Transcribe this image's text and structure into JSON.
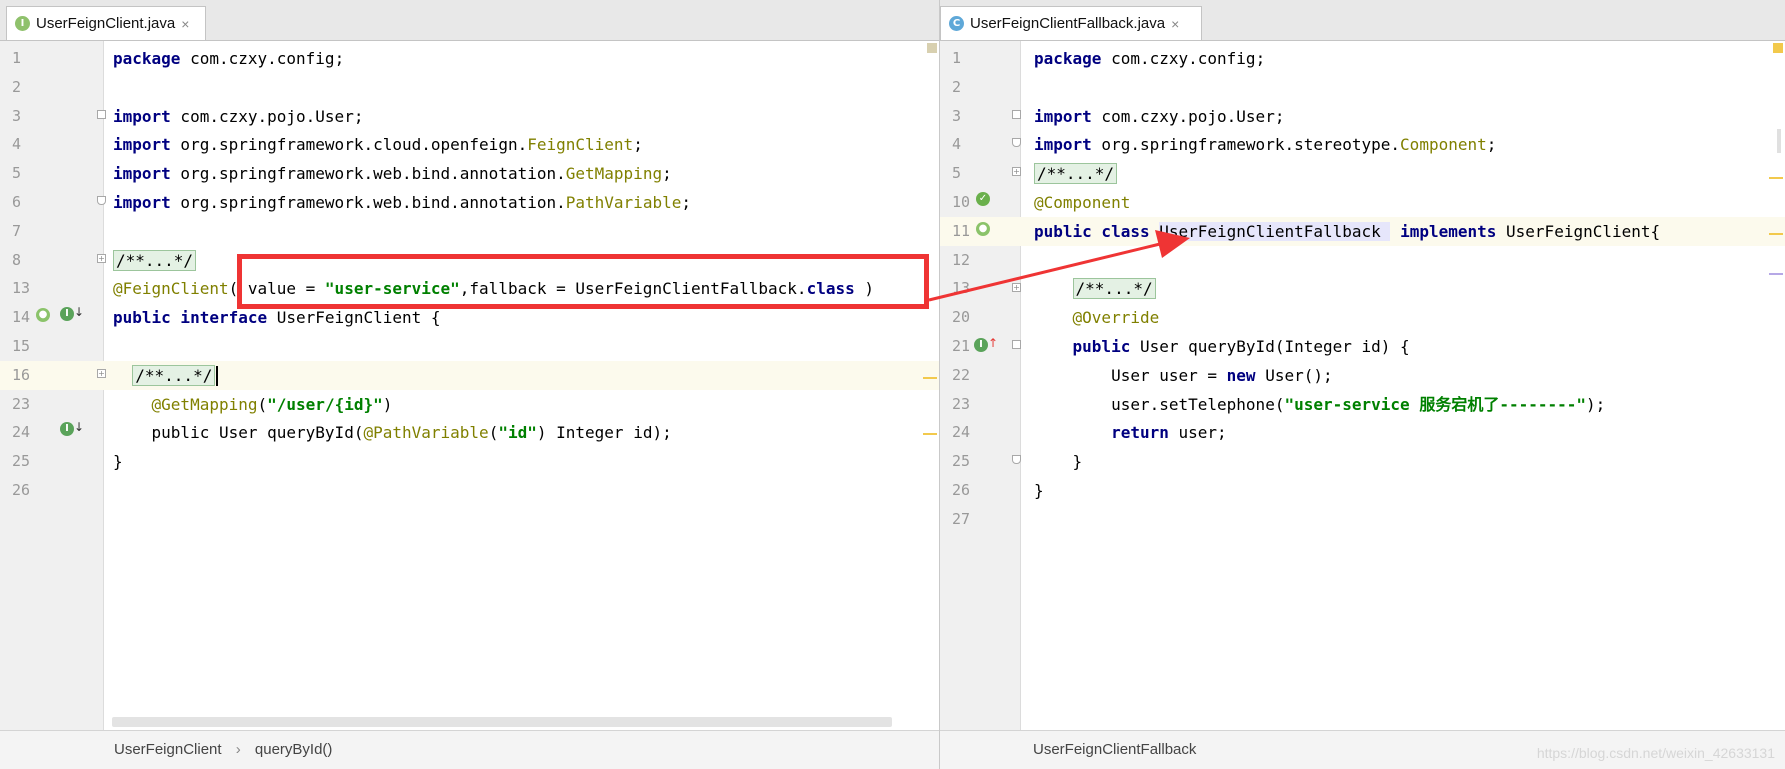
{
  "left_editor": {
    "tab": {
      "icon": "interface-icon",
      "icon_letter": "I",
      "label": "UserFeignClient.java",
      "close": "×"
    },
    "lines": [
      {
        "n": "1",
        "tokens": [
          [
            "kw",
            "package"
          ],
          [
            "t",
            " com.czxy.config;"
          ]
        ]
      },
      {
        "n": "2",
        "tokens": []
      },
      {
        "n": "3",
        "tokens": [
          [
            "kw",
            "import"
          ],
          [
            "t",
            " com.czxy.pojo.User;"
          ]
        ]
      },
      {
        "n": "4",
        "tokens": [
          [
            "kw",
            "import"
          ],
          [
            "t",
            " org.springframework.cloud.openfeign."
          ],
          [
            "cls",
            "FeignClient"
          ],
          [
            "t",
            ";"
          ]
        ]
      },
      {
        "n": "5",
        "tokens": [
          [
            "kw",
            "import"
          ],
          [
            "t",
            " org.springframework.web.bind.annotation."
          ],
          [
            "cls",
            "GetMapping"
          ],
          [
            "t",
            ";"
          ]
        ]
      },
      {
        "n": "6",
        "tokens": [
          [
            "kw",
            "import"
          ],
          [
            "t",
            " org.springframework.web.bind.annotation."
          ],
          [
            "cls",
            "PathVariable"
          ],
          [
            "t",
            ";"
          ]
        ]
      },
      {
        "n": "7",
        "tokens": []
      },
      {
        "n": "8",
        "tokens": [
          [
            "fold",
            "/**...*/"
          ]
        ]
      },
      {
        "n": "13",
        "tokens": [
          [
            "ann",
            "@FeignClient"
          ],
          [
            "t",
            "( value = "
          ],
          [
            "str",
            "\"user-service\""
          ],
          [
            "t",
            ",fallback = UserFeignClientFallback."
          ],
          [
            "kw",
            "class"
          ],
          [
            "t",
            " )"
          ]
        ]
      },
      {
        "n": "14",
        "tokens": [
          [
            "kw",
            "public interface"
          ],
          [
            "t",
            " UserFeignClient {"
          ]
        ]
      },
      {
        "n": "15",
        "tokens": []
      },
      {
        "n": "16",
        "tokens": [
          [
            "t",
            "  "
          ],
          [
            "fold",
            "/**...*/"
          ],
          [
            "caret",
            ""
          ]
        ]
      },
      {
        "n": "23",
        "tokens": [
          [
            "t",
            "    "
          ],
          [
            "ann",
            "@GetMapping"
          ],
          [
            "t",
            "("
          ],
          [
            "str",
            "\"/user/{id}\""
          ],
          [
            "t",
            ")"
          ]
        ]
      },
      {
        "n": "24",
        "tokens": [
          [
            "t",
            "    "
          ],
          [
            "t",
            "public User queryById("
          ],
          [
            "ann",
            "@PathVariable"
          ],
          [
            "t",
            "("
          ],
          [
            "str",
            "\"id\""
          ],
          [
            "t",
            ") Integer id);"
          ]
        ]
      },
      {
        "n": "25",
        "tokens": [
          [
            "t",
            "}"
          ]
        ]
      },
      {
        "n": "26",
        "tokens": []
      }
    ],
    "breadcrumb": [
      "UserFeignClient",
      "queryById()"
    ],
    "breadcrumb_sep": "›"
  },
  "right_editor": {
    "tab": {
      "icon": "class-icon",
      "icon_letter": "C",
      "label": "UserFeignClientFallback.java",
      "close": "×"
    },
    "lines": [
      {
        "n": "1",
        "tokens": [
          [
            "kw",
            "package"
          ],
          [
            "t",
            " com.czxy.config;"
          ]
        ]
      },
      {
        "n": "2",
        "tokens": []
      },
      {
        "n": "3",
        "tokens": [
          [
            "kw",
            "import"
          ],
          [
            "t",
            " com.czxy.pojo.User;"
          ]
        ]
      },
      {
        "n": "4",
        "tokens": [
          [
            "kw",
            "import"
          ],
          [
            "t",
            " org.springframework.stereotype."
          ],
          [
            "cls",
            "Component"
          ],
          [
            "t",
            ";"
          ]
        ]
      },
      {
        "n": "5",
        "tokens": [
          [
            "fold",
            "/**...*/"
          ]
        ]
      },
      {
        "n": "10",
        "tokens": [
          [
            "ann",
            "@Component"
          ]
        ]
      },
      {
        "n": "11",
        "tokens": [
          [
            "kw",
            "public class"
          ],
          [
            "t",
            " "
          ],
          [
            "sel",
            "UserFeignClientFallback "
          ],
          [
            "t",
            " "
          ],
          [
            "kw",
            "implements"
          ],
          [
            "t",
            " UserFeignClient{"
          ]
        ]
      },
      {
        "n": "12",
        "tokens": []
      },
      {
        "n": "13",
        "tokens": [
          [
            "t",
            "    "
          ],
          [
            "fold",
            "/**...*/"
          ]
        ]
      },
      {
        "n": "20",
        "tokens": [
          [
            "t",
            "    "
          ],
          [
            "ann",
            "@Override"
          ]
        ]
      },
      {
        "n": "21",
        "tokens": [
          [
            "t",
            "    "
          ],
          [
            "kw",
            "public"
          ],
          [
            "t",
            " User queryById(Integer id) {"
          ]
        ]
      },
      {
        "n": "22",
        "tokens": [
          [
            "t",
            "        User user = "
          ],
          [
            "kw",
            "new"
          ],
          [
            "t",
            " User();"
          ]
        ]
      },
      {
        "n": "23",
        "tokens": [
          [
            "t",
            "        user.setTelephone("
          ],
          [
            "str",
            "\"user-service 服务宕机了--------\""
          ],
          [
            "t",
            ");"
          ]
        ]
      },
      {
        "n": "24",
        "tokens": [
          [
            "t",
            "        "
          ],
          [
            "kw",
            "return"
          ],
          [
            "t",
            " user;"
          ]
        ]
      },
      {
        "n": "25",
        "tokens": [
          [
            "t",
            "    }"
          ]
        ]
      },
      {
        "n": "26",
        "tokens": [
          [
            "t",
            "}"
          ]
        ]
      },
      {
        "n": "27",
        "tokens": []
      }
    ],
    "breadcrumb": [
      "UserFeignClientFallback"
    ]
  },
  "watermark": "https://blog.csdn.net/weixin_42633131",
  "colors": {
    "annotation_box": "#ef3434",
    "arrow": "#ef3434",
    "keyword": "#000080",
    "string": "#008000",
    "annotation": "#808000"
  }
}
